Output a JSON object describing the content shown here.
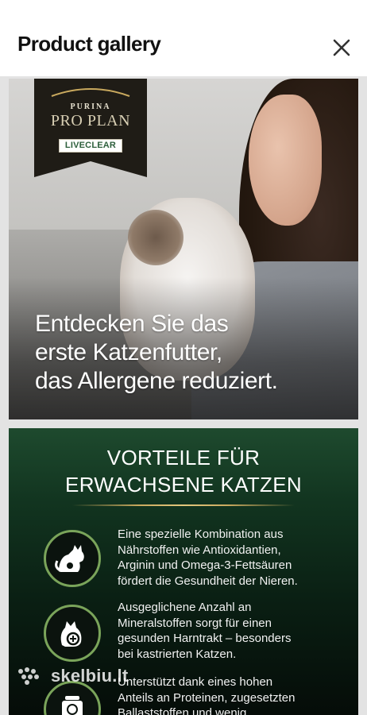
{
  "header": {
    "title": "Product gallery",
    "close_icon": "close-icon"
  },
  "gallery": {
    "image1": {
      "brand_badge": {
        "purina": "PURINA",
        "proplan": "PRO PLAN",
        "line": "LIVECLEAR"
      },
      "headline": [
        "Entdecken Sie das",
        "erste Katzenfutter,",
        "das Allergene reduziert."
      ]
    },
    "image2": {
      "title": [
        "VORTEILE FÜR",
        "ERWACHSENE KATZEN"
      ],
      "benefits": [
        {
          "icon": "cat-kidney-icon",
          "lines": [
            "Eine spezielle Kombination aus",
            "Nährstoffen wie Antioxidantien,",
            "Arginin und Omega-3-Fettsäuren",
            "fördert die Gesundheit der Nieren."
          ]
        },
        {
          "icon": "urinary-tract-icon",
          "lines": [
            "Ausgeglichene Anzahl an",
            "Mineralstoffen sorgt für einen",
            "gesunden Harntrakt – besonders",
            "bei kastrierten Katzen."
          ]
        },
        {
          "icon": "weight-scale-icon",
          "lines": [
            "Unterstützt dank eines hohen",
            "Anteils an Proteinen, zugesetzten",
            "Ballaststoffen und wenig"
          ]
        }
      ]
    },
    "watermark": "skelbiu.lt"
  },
  "colors": {
    "accent_green": "#7aa45a",
    "gold": "#c9a95e",
    "badge_dark": "#1f1c16"
  }
}
